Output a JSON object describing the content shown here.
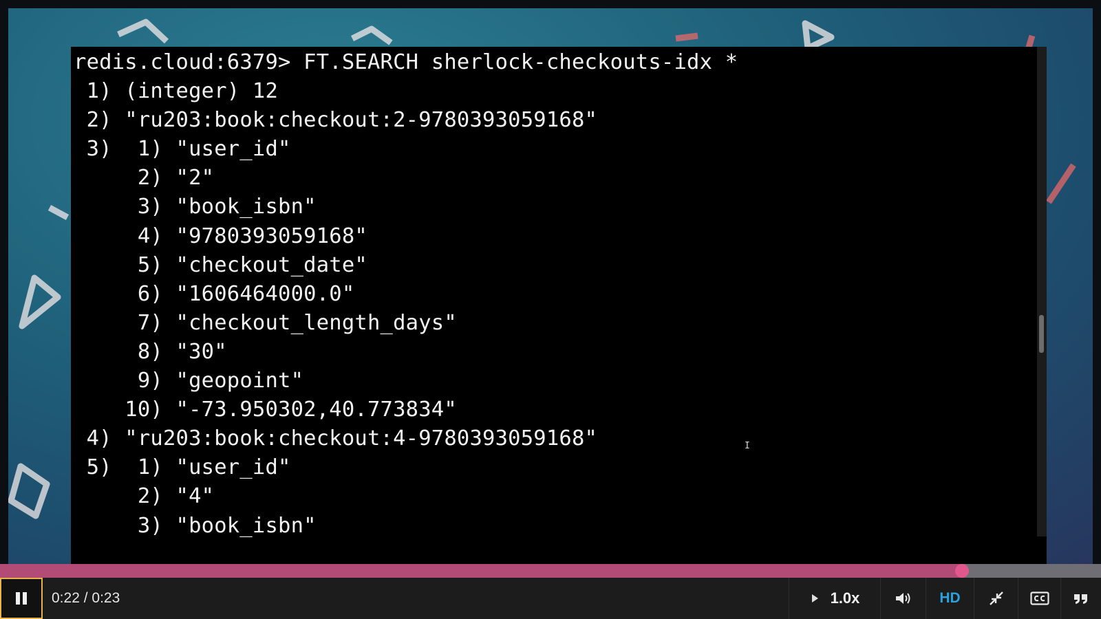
{
  "terminal": {
    "lines": [
      "redis.cloud:6379> FT.SEARCH sherlock-checkouts-idx *",
      " 1) (integer) 12",
      " 2) \"ru203:book:checkout:2-9780393059168\"",
      " 3)  1) \"user_id\"",
      "     2) \"2\"",
      "     3) \"book_isbn\"",
      "     4) \"9780393059168\"",
      "     5) \"checkout_date\"",
      "     6) \"1606464000.0\"",
      "     7) \"checkout_length_days\"",
      "     8) \"30\"",
      "     9) \"geopoint\"",
      "    10) \"-73.950302,40.773834\"",
      " 4) \"ru203:book:checkout:4-9780393059168\"",
      " 5)  1) \"user_id\"",
      "     2) \"4\"",
      "     3) \"book_isbn\""
    ],
    "cursor_glyph": "I"
  },
  "player": {
    "current_time": "0:22",
    "separator": " / ",
    "duration": "0:23",
    "progress_fraction": 0.874,
    "speed": "1.0x",
    "quality": "HD",
    "colors": {
      "progress_played": "#b24b76",
      "progress_handle": "#e2588d",
      "hd_active": "#2aa2e0",
      "play_focus_border": "#e8b44a"
    },
    "icons": [
      "pause-icon",
      "play-triangle-icon",
      "volume-icon",
      "shrink-icon",
      "cc-icon",
      "quote-icon"
    ]
  }
}
